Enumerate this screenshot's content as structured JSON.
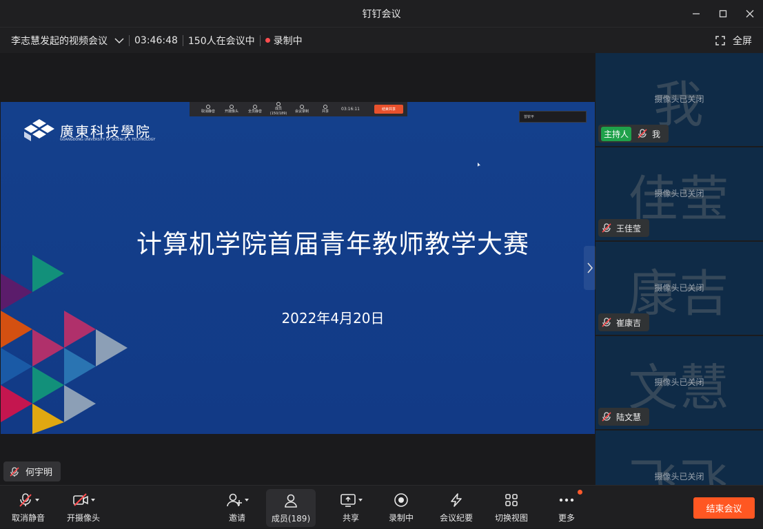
{
  "window": {
    "title": "钉钉会议"
  },
  "infobar": {
    "meeting_name": "李志慧发起的视频会议",
    "duration": "03:46:48",
    "participants": "150人在会议中",
    "recording": "录制中",
    "fullscreen": "全屏"
  },
  "slide": {
    "logo_text": "廣東科技學院",
    "logo_sub": "GUANGDONG UNIVERSITY OF SCIENCE & TECHNOLOGY",
    "title": "计算机学院首届青年教师教学大赛",
    "date": "2022年4月20日",
    "mini_toolbar": [
      "取消静音",
      "开摄像头",
      "全员静音",
      "成员(150/189)",
      "会议录制",
      "共享"
    ],
    "mini_time": "03:16:11",
    "mini_end": "结束共享",
    "mini_speaker": "曾钦平"
  },
  "speaker_tag": "何宇明",
  "sidebar": {
    "camera_off": "摄像头已关闭",
    "host_badge": "主持人",
    "tiles": [
      {
        "bg": "我",
        "name": "我"
      },
      {
        "bg": "佳莹",
        "name": "王佳莹"
      },
      {
        "bg": "康吉",
        "name": "崔康吉"
      },
      {
        "bg": "文慧",
        "name": "陆文慧"
      },
      {
        "bg": "飞飞",
        "name": ""
      }
    ]
  },
  "toolbar": {
    "unmute": "取消静音",
    "camera": "开摄像头",
    "invite": "邀请",
    "members": "成员(189)",
    "share": "共享",
    "recording": "录制中",
    "minutes": "会议纪要",
    "switch_view": "切换视图",
    "more": "更多",
    "end": "结束会议"
  },
  "colors": {
    "slide_bg": "#123a86",
    "end_button": "#ff5722",
    "host_badge": "#1fa14a",
    "tile_bg": "#0f2b47"
  }
}
